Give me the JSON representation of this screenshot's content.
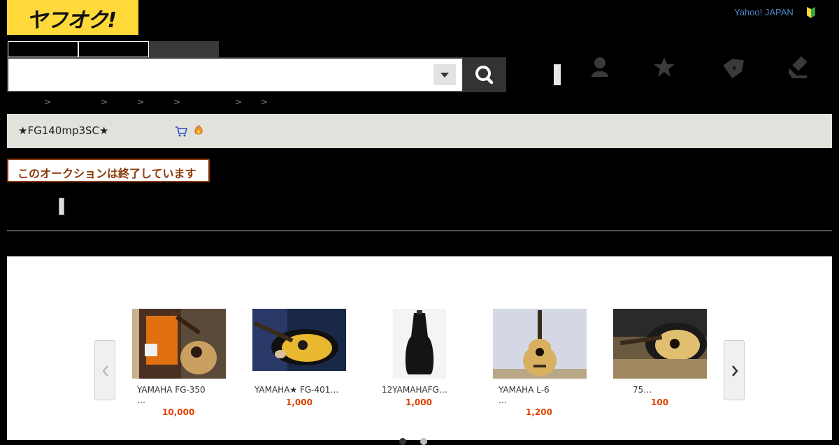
{
  "header": {
    "logo_text": "ヤフオク!",
    "yahoo_link": "Yahoo! JAPAN"
  },
  "breadcrumb_separators": [
    ">",
    ">",
    ">",
    ">",
    ">",
    ">"
  ],
  "auction": {
    "title": "★FG140mp3SC★",
    "status": "このオークションは終了しています"
  },
  "recommendations": [
    {
      "name": "YAMAHA FG-350",
      "sub": "…",
      "price": "10,000"
    },
    {
      "name": "YAMAHA★ FG-401…",
      "sub": "",
      "price": "1,000"
    },
    {
      "name": "12YAMAHAFG…",
      "sub": "",
      "price": "1,000"
    },
    {
      "name": "YAMAHA L-6",
      "sub": "…",
      "price": "1,200"
    },
    {
      "name": "75…",
      "sub": "",
      "price": "100"
    }
  ],
  "colors": {
    "logo_bg": "#ffd93a",
    "price": "#e04000",
    "ended_border": "#8a3a0a"
  },
  "icons": [
    "search-icon",
    "user-icon",
    "star-icon",
    "coupon-tag-icon",
    "auction-gavel-icon",
    "cart-icon",
    "fire-icon",
    "beginner-mark-icon",
    "chevron-left-icon",
    "chevron-right-icon"
  ]
}
